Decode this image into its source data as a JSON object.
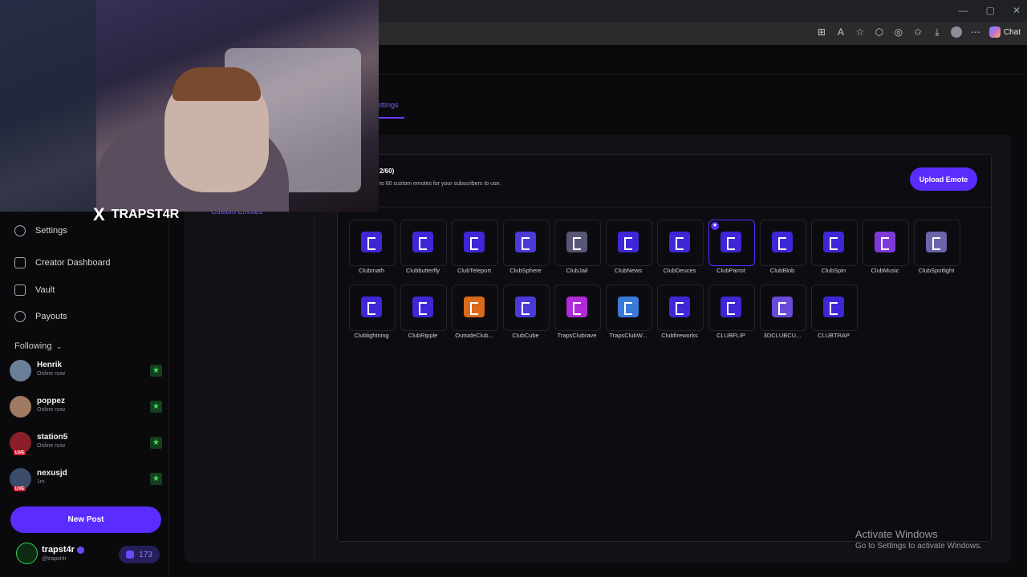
{
  "browser": {
    "window_controls": [
      "—",
      "▢",
      "✕"
    ],
    "toolbar_icons": [
      "apps-icon",
      "read-aloud-icon",
      "favorite-icon",
      "extensions-icon",
      "copilot-extension-icon",
      "favorites-icon",
      "downloads-icon",
      "profile-icon",
      "more-icon"
    ],
    "chat_label": "Chat"
  },
  "page": {
    "active_tab": "ettings",
    "sidebar_partial_link": "Custom Emotes"
  },
  "sidebar": {
    "items": [
      {
        "label": "Settings",
        "icon": "gear-icon"
      },
      {
        "label": "Creator Dashboard",
        "icon": "dashboard-icon"
      },
      {
        "label": "Vault",
        "icon": "vault-icon"
      },
      {
        "label": "Payouts",
        "icon": "dollar-icon"
      }
    ],
    "following_label": "Following",
    "following": [
      {
        "name": "Henrik",
        "status": "Online now",
        "live": false
      },
      {
        "name": "poppez",
        "status": "Online now",
        "live": false
      },
      {
        "name": "station5",
        "status": "Online now",
        "live": true
      },
      {
        "name": "nexusjd",
        "status": "1m",
        "live": true
      }
    ],
    "live_badge": "LIVE",
    "new_post_label": "New Post",
    "user": {
      "name": "trapst4r",
      "handle": "@trapst4r",
      "credits": "173"
    }
  },
  "emotes": {
    "slots": "2/60)",
    "description": "to 60 custom emotes for your subscribers to use.",
    "upload_label": "Upload Emote",
    "items": [
      {
        "name": "Clubmath",
        "color": "#3e27d6"
      },
      {
        "name": "Clubbutterfly",
        "color": "#3e27d6"
      },
      {
        "name": "ClubTeleport",
        "color": "#3e27d6"
      },
      {
        "name": "ClubSphere",
        "color": "#4a3ad8"
      },
      {
        "name": "ClubJail",
        "color": "#575775"
      },
      {
        "name": "ClubNews",
        "color": "#3e27d6"
      },
      {
        "name": "ClubDeuces",
        "color": "#3e27d6"
      },
      {
        "name": "ClubParrot",
        "color": "#3e27d6",
        "selected": true
      },
      {
        "name": "ClubBlob",
        "color": "#3e27d6"
      },
      {
        "name": "ClubSpin",
        "color": "#3e27d6"
      },
      {
        "name": "ClubMusic",
        "color": "#7d3ad8"
      },
      {
        "name": "ClubSpotlight",
        "color": "#6a64a8"
      },
      {
        "name": "Clublightning",
        "color": "#3e27d6"
      },
      {
        "name": "ClubRipple",
        "color": "#3e27d6"
      },
      {
        "name": "OutsideClub...",
        "color": "#d86a1a"
      },
      {
        "name": "ClubCube",
        "color": "#4a3ad8"
      },
      {
        "name": "TrapsClubrave",
        "color": "#b02ad8"
      },
      {
        "name": "TrapsClubW...",
        "color": "#3a7ad8"
      },
      {
        "name": "Clubfireworks",
        "color": "#3e27d6"
      },
      {
        "name": "CLUBFLIP",
        "color": "#3e27d6"
      },
      {
        "name": "3DCLUBCU...",
        "color": "#6a4ad8"
      },
      {
        "name": "CLUBTRAP",
        "color": "#3e27d6"
      }
    ]
  },
  "watermark": {
    "title": "Activate Windows",
    "subtitle": "Go to Settings to activate Windows."
  },
  "webcam": {
    "name": "TRAPST4R",
    "x_logo": "X"
  }
}
